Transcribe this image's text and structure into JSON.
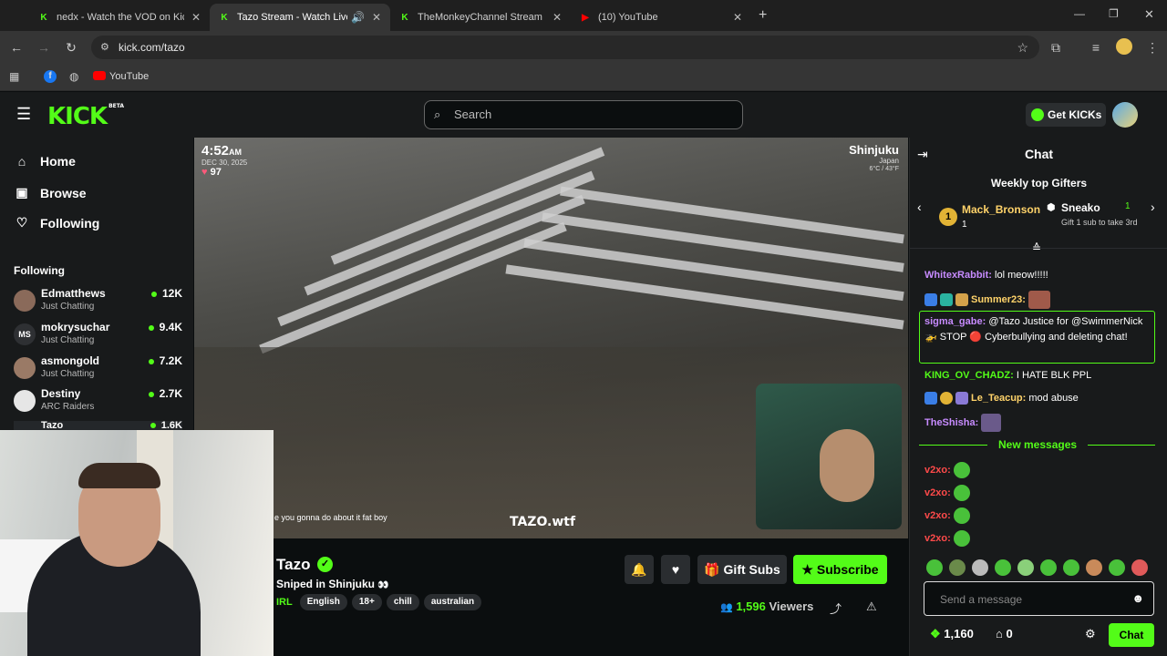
{
  "browser": {
    "tabs": [
      {
        "title": "nedx - Watch the VOD on Kick"
      },
      {
        "title": "Tazo Stream - Watch Live on"
      },
      {
        "title": "TheMonkeyChannel Stream - W"
      },
      {
        "title": "(10) YouTube"
      }
    ],
    "url": "kick.com/tazo",
    "bookmarks": [
      "YouTube"
    ]
  },
  "header": {
    "logo": "KICK",
    "logo_badge": "BETA",
    "search_placeholder": "Search",
    "get_kicks": "Get KICKs"
  },
  "sidebar": {
    "nav": [
      "Home",
      "Browse",
      "Following"
    ],
    "section_title": "Following",
    "following": [
      {
        "name": "Edmatthews",
        "category": "Just Chatting",
        "viewers": "12K"
      },
      {
        "name": "mokrysuchar",
        "category": "Just Chatting",
        "viewers": "9.4K",
        "avatar_text": "MS"
      },
      {
        "name": "asmongold",
        "category": "Just Chatting",
        "viewers": "7.2K"
      },
      {
        "name": "Destiny",
        "category": "ARC Raiders",
        "viewers": "2.7K"
      },
      {
        "name": "Tazo",
        "category": "",
        "viewers": "1.6K"
      }
    ]
  },
  "video": {
    "overlay_time": "4:52",
    "overlay_ampm": "AM",
    "overlay_date": "DEC 30, 2025",
    "overlay_heart": "97",
    "overlay_location": "Shinjuku",
    "overlay_sub": "Japan",
    "overlay_temp": "6°C / 43°F",
    "caption": "e you gonna do about it fat boy",
    "watermark": "TAZO.wtf"
  },
  "stream": {
    "name": "Tazo",
    "title": "Sniped in Shinjuku",
    "category": "IRL",
    "tags": [
      "English",
      "18+",
      "chill",
      "australian"
    ],
    "viewers": "1,596",
    "viewers_label": "Viewers",
    "gift_label": "Gift Subs",
    "subscribe_label": "Subscribe"
  },
  "chat": {
    "title": "Chat",
    "gifters_title": "Weekly top Gifters",
    "gifter1": {
      "name": "Mack_Bronson",
      "count": "1",
      "rank": "1"
    },
    "gifter2": {
      "name": "Sneako",
      "count": "1",
      "note": "Gift 1 sub to take 3rd"
    },
    "messages": [
      {
        "user": "WhitexRabbit:",
        "text": "lol meow!!!!!",
        "color": "#c78bff"
      },
      {
        "user": "Summer23:",
        "text": "",
        "color": "#ffd36a"
      },
      {
        "user": "sigma_gabe:",
        "text": "@Tazo Justice for @SwimmerNick 🚁 STOP 🔴 Cyberbullying and deleting chat!",
        "color": "#c78bff"
      },
      {
        "user": "KING_OV_CHADZ:",
        "text": "I HATE BLK PPL",
        "color": "#53fc18"
      },
      {
        "user": "Le_Teacup:",
        "text": "mod abuse",
        "color": "#ffd36a"
      },
      {
        "user": "TheShisha:",
        "text": "",
        "color": "#c78bff"
      }
    ],
    "new_messages": "New messages",
    "v2xo_user": "v2xo:",
    "input_placeholder": "Send a message",
    "points": "1,160",
    "zero": "0",
    "send_label": "Chat"
  },
  "colors": {
    "accent": "#53fc18",
    "bg": "#0b0e0f",
    "panel": "#181a1b"
  }
}
